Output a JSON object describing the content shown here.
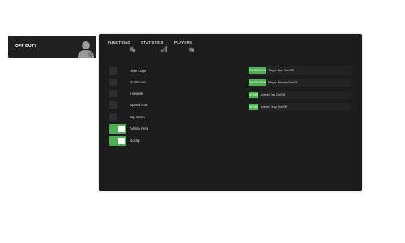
{
  "duty_card": {
    "label": "OFF DUTY"
  },
  "tabs": [
    {
      "label": "FUNCTIONS",
      "icon": "gear-icon"
    },
    {
      "label": "STATISTICS",
      "icon": "chart-icon"
    },
    {
      "label": "PLAYERS",
      "icon": "players-icon"
    }
  ],
  "toggles": [
    {
      "label": "Hide Logs",
      "state": "off"
    },
    {
      "label": "Godmode",
      "state": "off"
    },
    {
      "label": "Invisible",
      "state": "off"
    },
    {
      "label": "Speed Run",
      "state": "off"
    },
    {
      "label": "Big Jump",
      "state": "off"
    },
    {
      "label": "Admin Area",
      "state": "on"
    },
    {
      "label": "Noclip",
      "state": "on"
    }
  ],
  "keybinds": [
    {
      "key": "PAGEDOWN",
      "label": "Target Eye Ban/Off"
    },
    {
      "key": "PAGEDOWN",
      "label": "Player Names On/Off"
    },
    {
      "key": "HOME",
      "label": "Admin Tag On/Off"
    },
    {
      "key": "HOME",
      "label": "Admin Duty On/Off"
    }
  ],
  "colors": {
    "accent": "#4caf50",
    "panel_bg": "#1c1c1c",
    "card_bg": "#202020"
  }
}
